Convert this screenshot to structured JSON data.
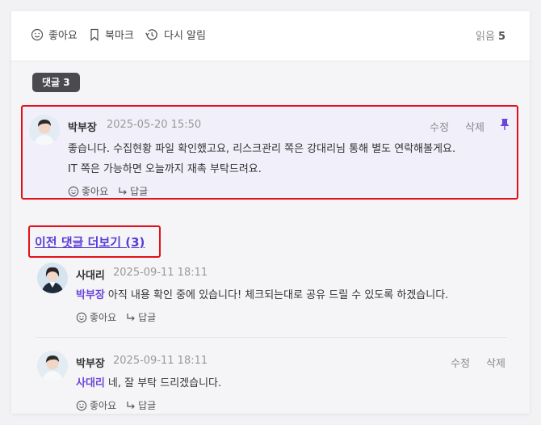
{
  "top_bar": {
    "like_label": "좋아요",
    "bookmark_label": "북마크",
    "remind_label": "다시 알림",
    "read_label": "읽음",
    "read_count": "5"
  },
  "comments": {
    "badge": "댓글 3",
    "pinned": {
      "author": "박부장",
      "date": "2025-05-20 15:50",
      "edit": "수정",
      "delete": "삭제",
      "line1": "좋습니다. 수집현황 파일 확인했고요, 리스크관리 쪽은 강대리님 통해 별도 연락해볼게요.",
      "line2": "IT 쪽은 가능하면 오늘까지 재촉 부탁드려요.",
      "like": "좋아요",
      "reply": "답글"
    },
    "more_link": "이전 댓글 더보기 (3)",
    "replies": [
      {
        "author": "사대리",
        "date": "2025-09-11 18:11",
        "mention": "박부장",
        "text": "아직 내용 확인 중에 있습니다! 체크되는대로 공유 드릴 수 있도록 하겠습니다.",
        "like": "좋아요",
        "reply": "답글"
      },
      {
        "author": "박부장",
        "date": "2025-09-11 18:11",
        "edit": "수정",
        "delete": "삭제",
        "mention": "사대리",
        "text": "네, 잘 부탁 드리겠습니다.",
        "like": "좋아요",
        "reply": "답글"
      }
    ]
  },
  "colors": {
    "accent": "#6b45d9",
    "highlight_border": "#e3101a",
    "pinned_bg": "#f1effa",
    "badge_bg": "#4a4a4f"
  },
  "icons": [
    "smile-icon",
    "bookmark-icon",
    "history-icon",
    "pin-icon",
    "reply-arrow-icon"
  ]
}
